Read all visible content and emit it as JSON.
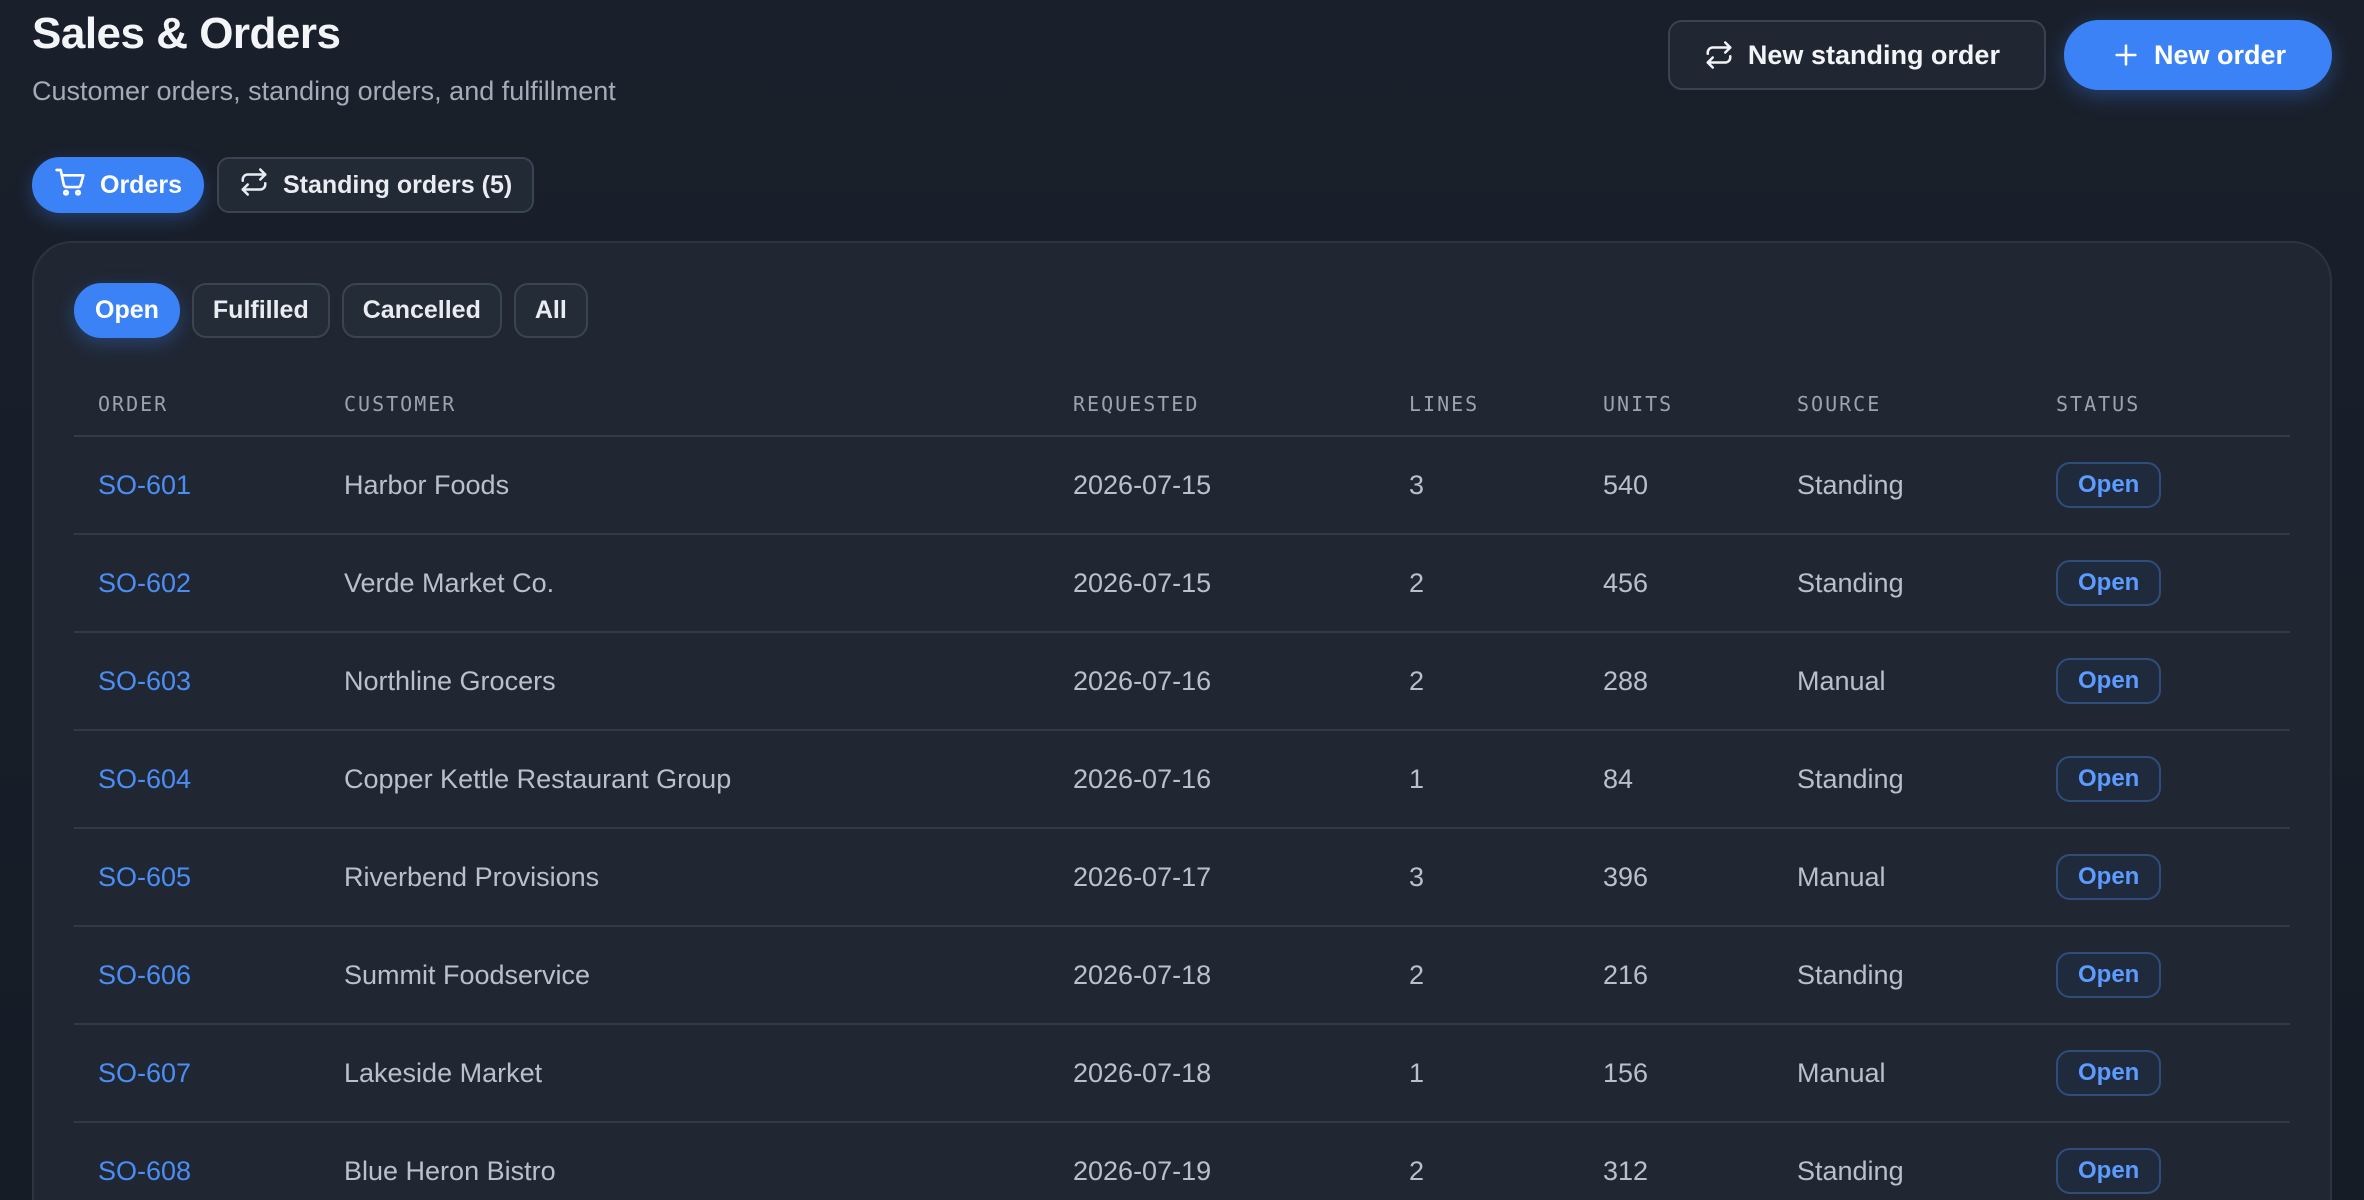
{
  "header": {
    "title": "Sales & Orders",
    "subtitle": "Customer orders, standing orders, and fulfillment",
    "new_standing_order_label": "New standing order",
    "new_order_label": "New order"
  },
  "tabs": [
    {
      "label": "Orders",
      "icon": "cart-icon",
      "active": true
    },
    {
      "label": "Standing orders (5)",
      "icon": "repeat-icon",
      "active": false
    }
  ],
  "filters": [
    {
      "label": "Open",
      "active": true
    },
    {
      "label": "Fulfilled",
      "active": false
    },
    {
      "label": "Cancelled",
      "active": false
    },
    {
      "label": "All",
      "active": false
    }
  ],
  "table": {
    "columns": [
      "ORDER",
      "CUSTOMER",
      "REQUESTED",
      "LINES",
      "UNITS",
      "SOURCE",
      "STATUS"
    ],
    "rows": [
      {
        "order": "SO-601",
        "customer": "Harbor Foods",
        "requested": "2026-07-15",
        "lines": "3",
        "units": "540",
        "source": "Standing",
        "status": "Open"
      },
      {
        "order": "SO-602",
        "customer": "Verde Market Co.",
        "requested": "2026-07-15",
        "lines": "2",
        "units": "456",
        "source": "Standing",
        "status": "Open"
      },
      {
        "order": "SO-603",
        "customer": "Northline Grocers",
        "requested": "2026-07-16",
        "lines": "2",
        "units": "288",
        "source": "Manual",
        "status": "Open"
      },
      {
        "order": "SO-604",
        "customer": "Copper Kettle Restaurant Group",
        "requested": "2026-07-16",
        "lines": "1",
        "units": "84",
        "source": "Standing",
        "status": "Open"
      },
      {
        "order": "SO-605",
        "customer": "Riverbend Provisions",
        "requested": "2026-07-17",
        "lines": "3",
        "units": "396",
        "source": "Manual",
        "status": "Open"
      },
      {
        "order": "SO-606",
        "customer": "Summit Foodservice",
        "requested": "2026-07-18",
        "lines": "2",
        "units": "216",
        "source": "Standing",
        "status": "Open"
      },
      {
        "order": "SO-607",
        "customer": "Lakeside Market",
        "requested": "2026-07-18",
        "lines": "1",
        "units": "156",
        "source": "Manual",
        "status": "Open"
      },
      {
        "order": "SO-608",
        "customer": "Blue Heron Bistro",
        "requested": "2026-07-19",
        "lines": "2",
        "units": "312",
        "source": "Standing",
        "status": "Open"
      }
    ]
  },
  "colors": {
    "accent": "#3b82f6",
    "background": "#161c27",
    "card": "#202733",
    "link": "#4a8ef5"
  }
}
